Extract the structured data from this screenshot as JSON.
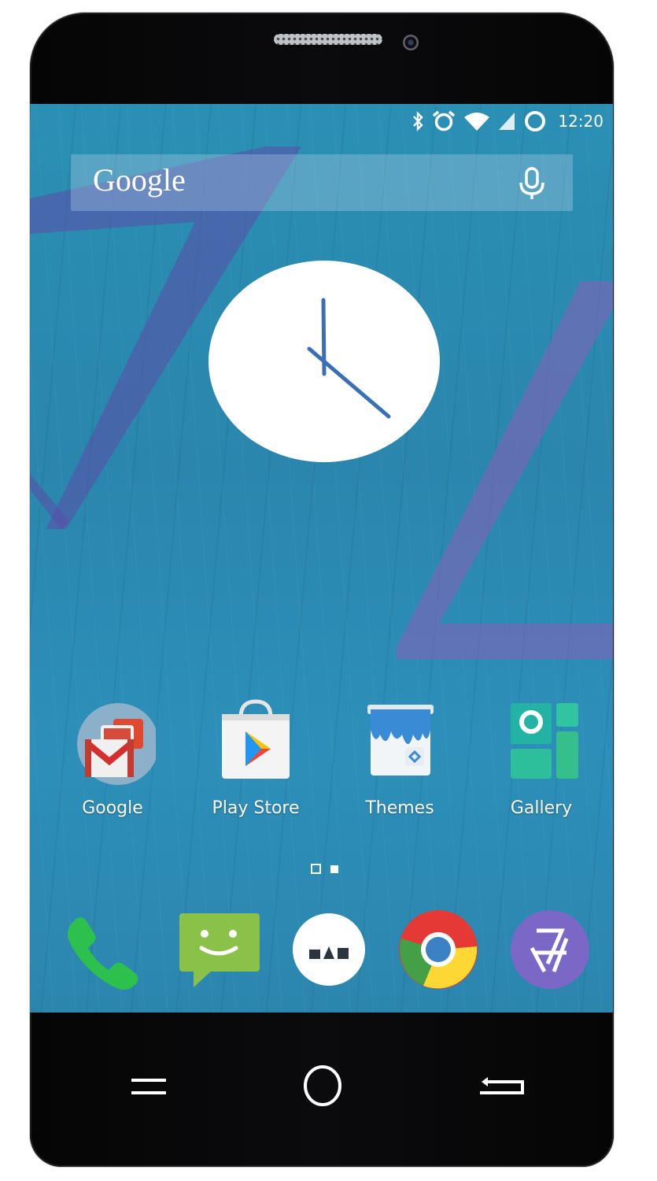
{
  "status_bar": {
    "time": "12:20",
    "icons": [
      "bluetooth-icon",
      "alarm-icon",
      "wifi-icon",
      "cell-signal-icon",
      "battery-ring-icon"
    ]
  },
  "search": {
    "brand": "Google",
    "mic_icon": "mic-icon"
  },
  "clock_widget": {
    "type": "analog",
    "hour_hand": "12:20"
  },
  "apps": [
    {
      "label": "Google",
      "icon": "google-folder-icon"
    },
    {
      "label": "Play Store",
      "icon": "play-store-icon"
    },
    {
      "label": "Themes",
      "icon": "themes-icon"
    },
    {
      "label": "Gallery",
      "icon": "gallery-icon"
    }
  ],
  "page_indicator": {
    "pages": 2,
    "current": 1
  },
  "dock": [
    {
      "icon": "phone-icon"
    },
    {
      "icon": "messaging-icon"
    },
    {
      "icon": "app-drawer-icon"
    },
    {
      "icon": "chrome-icon"
    },
    {
      "icon": "camera-icon"
    }
  ],
  "nav_bar": {
    "buttons": [
      "menu-icon",
      "home-icon",
      "back-icon"
    ]
  },
  "colors": {
    "wallpaper": "#2b8fb4",
    "accent_purple": "#6c5fb3",
    "clock_hand": "#3a6fb5",
    "dock_phone": "#2ec04c",
    "dock_messaging": "#8ac249"
  }
}
